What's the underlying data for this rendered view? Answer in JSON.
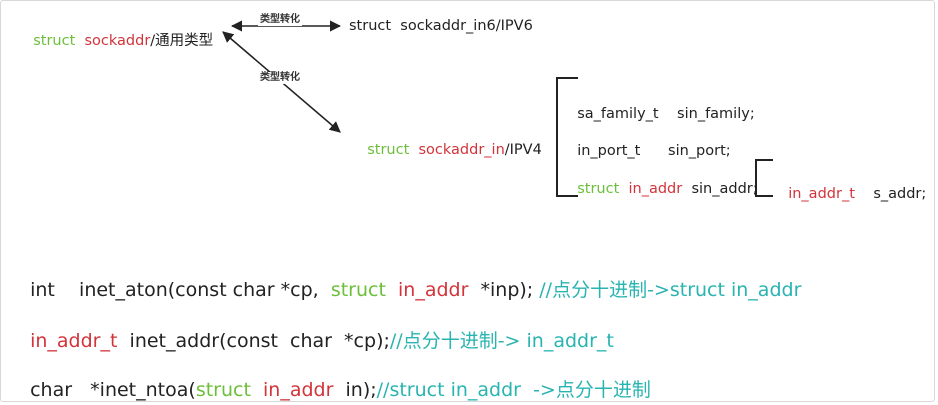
{
  "colors": {
    "keyword_green": "#6cbf3a",
    "type_red": "#d2343a",
    "comment_teal": "#29b4b1",
    "text_dark": "#222222"
  },
  "diagram": {
    "generic": {
      "kw": "struct",
      "name": "sockaddr",
      "suffix": "/通用类型"
    },
    "conversion_label": "类型转化",
    "ipv6": {
      "text": "struct  sockaddr_in6/IPV6"
    },
    "ipv4": {
      "kw": "struct",
      "name": "sockaddr_in",
      "suffix": "/IPV4"
    },
    "fields": {
      "family": {
        "type": "sa_family_t",
        "name": "sin_family;"
      },
      "port": {
        "type": "in_port_t",
        "name": "sin_port;"
      },
      "addr": {
        "kw": "struct",
        "type": "in_addr",
        "name": "sin_addr;"
      }
    },
    "in_addr_field": {
      "type": "in_addr_t",
      "name": "s_addr;"
    }
  },
  "functions": [
    {
      "ret": "int",
      "sig_a": "inet_aton(const char *cp,",
      "kw": "struct",
      "type": "in_addr",
      "sig_b": "*inp);",
      "comment": "//点分十进制->struct in_addr"
    },
    {
      "ret": "in_addr_t",
      "sig": "inet_addr(const  char  *cp);",
      "comment": "//点分十进制-> in_addr_t"
    },
    {
      "ret": "char",
      "sig_a": "*inet_ntoa(",
      "kw": "struct",
      "type": "in_addr",
      "sig_b": "in);",
      "comment": "//struct in_addr  ->点分十进制"
    }
  ]
}
